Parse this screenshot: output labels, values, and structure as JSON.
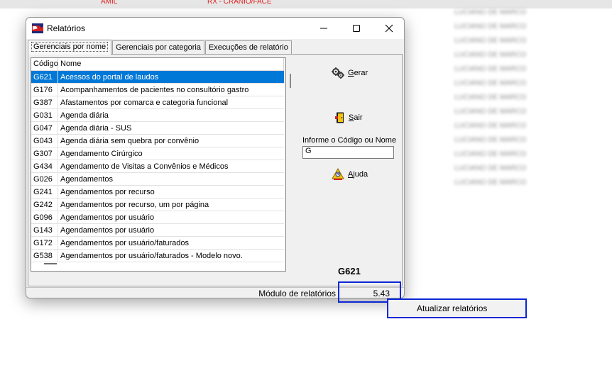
{
  "background": {
    "top_left_text": "AMIL",
    "top_mid_text": "RX - CRANIO/FACE",
    "names": [
      "LUCIANO DE MARCO",
      "LUCIANO DE MARCO",
      "LUCIANO DE MARCO",
      "LUCIANO DE MARCO",
      "LUCIANO DE MARCO",
      "LUCIANO DE MARCO",
      "LUCIANO DE MARCO",
      "LUCIANO DE MARCO",
      "LUCIANO DE MARCO",
      "LUCIANO DE MARCO",
      "LUCIANO DE MARCO",
      "LUCIANO DE MARCO",
      "LUCIANO DE MARCO"
    ]
  },
  "window": {
    "title": "Relatórios",
    "controls": {
      "minimize": "minimize-icon",
      "maximize": "maximize-icon",
      "close": "close-icon"
    }
  },
  "tabs": [
    {
      "label": "Gerenciais por nome",
      "active": true
    },
    {
      "label": "Gerenciais por categoria",
      "active": false
    },
    {
      "label": "Execuções de relatório",
      "active": false
    }
  ],
  "list": {
    "columns": {
      "code": "Código",
      "name": "Nome"
    },
    "rows": [
      {
        "code": "G621",
        "name": "Acessos do portal de laudos",
        "selected": true
      },
      {
        "code": "G176",
        "name": "Acompanhamentos de pacientes no consultório gastro"
      },
      {
        "code": "G387",
        "name": "Afastamentos por comarca e categoria funcional"
      },
      {
        "code": "G031",
        "name": "Agenda diária"
      },
      {
        "code": "G047",
        "name": "Agenda diária - SUS"
      },
      {
        "code": "G043",
        "name": "Agenda diária sem quebra por convênio"
      },
      {
        "code": "G307",
        "name": "Agendamento Cirúrgico"
      },
      {
        "code": "G434",
        "name": "Agendamento de Visitas a Convênios e Médicos"
      },
      {
        "code": "G026",
        "name": "Agendamentos"
      },
      {
        "code": "G241",
        "name": "Agendamentos por recurso"
      },
      {
        "code": "G242",
        "name": "Agendamentos por recurso, um por página"
      },
      {
        "code": "G096",
        "name": "Agendamentos por usuário"
      },
      {
        "code": "G143",
        "name": "Agendamentos por usuário"
      },
      {
        "code": "G172",
        "name": "Agendamentos por usuário/faturados"
      },
      {
        "code": "G538",
        "name": "Agendamentos por usuário/faturados - Modelo novo."
      }
    ]
  },
  "actions": {
    "generate": {
      "mnemonic": "G",
      "rest": "erar",
      "icon": "gears-icon"
    },
    "exit": {
      "mnemonic": "S",
      "rest": "air",
      "icon": "exit-door-icon"
    },
    "help": {
      "mnemonic": "A",
      "rest": "juda",
      "icon": "help-icon"
    },
    "search_label": "Informe o Código ou Nome",
    "search_value": "G",
    "selected_code": "G621"
  },
  "status": {
    "module_label": "Módulo de relatórios",
    "version": "5.43"
  },
  "context_menu": {
    "items": [
      {
        "label": "Atualizar relatórios"
      }
    ]
  },
  "colors": {
    "selection": "#0078d7",
    "highlight_box": "#0a26d6",
    "background_red_text": "#e02020"
  }
}
